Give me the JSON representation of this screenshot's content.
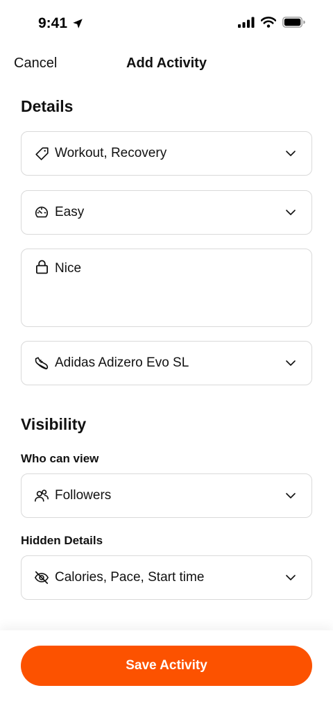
{
  "status_bar": {
    "time": "9:41",
    "icons": [
      "location-arrow-icon",
      "signal-icon",
      "wifi-icon",
      "battery-icon"
    ]
  },
  "nav": {
    "cancel_label": "Cancel",
    "title": "Add Activity"
  },
  "details": {
    "title": "Details",
    "tags": {
      "value": "Workout, Recovery",
      "icon": "tag-icon"
    },
    "effort": {
      "value": "Easy",
      "icon": "gauge-icon"
    },
    "private_notes": {
      "value": "Nice",
      "icon": "lock-icon"
    },
    "gear": {
      "value": "Adidas Adizero Evo SL",
      "icon": "shoe-icon"
    }
  },
  "visibility": {
    "title": "Visibility",
    "who_can_view_label": "Who can view",
    "who_can_view": {
      "value": "Followers",
      "icon": "people-icon"
    },
    "hidden_details_label": "Hidden Details",
    "hidden_details": {
      "value": "Calories, Pace, Start time",
      "icon": "eye-slash-icon"
    }
  },
  "footer": {
    "save_label": "Save Activity"
  },
  "colors": {
    "accent": "#fc5200",
    "border": "#d9d9d9",
    "text": "#111111"
  }
}
